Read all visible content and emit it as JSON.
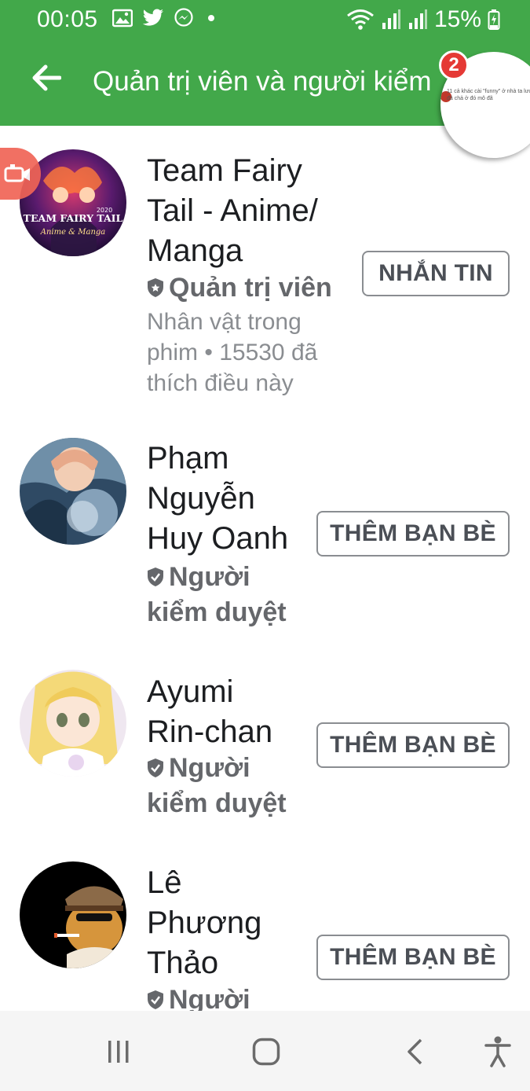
{
  "status": {
    "time": "00:05",
    "battery": "15%"
  },
  "appbar": {
    "title": "Quản trị viên và người kiểm duyệt"
  },
  "chathead": {
    "badge_count": "2",
    "preview_text": "11 cả khác cài \"funny\" ở nhà ta lưu đã chả ở đó mô đã"
  },
  "members": [
    {
      "name_lines": [
        "Team Fairy",
        "Tail - Anime/",
        "Manga"
      ],
      "role": "Quản trị viên",
      "meta_lines": [
        "Nhân vật trong",
        "phim • 15530 đã",
        "thích điều này"
      ],
      "action": "NHẮN TIN"
    },
    {
      "name_lines": [
        "Phạm",
        "Nguyễn",
        "Huy Oanh"
      ],
      "role_lines": [
        "Người",
        "kiểm duyệt"
      ],
      "action": "THÊM BẠN BÈ"
    },
    {
      "name_lines": [
        "Ayumi",
        "Rin-chan"
      ],
      "role_lines": [
        "Người",
        "kiểm duyệt"
      ],
      "action": "THÊM BẠN BÈ"
    },
    {
      "name_lines": [
        "Lê",
        "Phương",
        "Thảo"
      ],
      "role_lines": [
        "Người"
      ],
      "action": "THÊM BẠN BÈ"
    }
  ],
  "avatar_texts": {
    "member1": "TEAM FAIRY TAIL",
    "member1_sub": "Anime & Manga",
    "member1_year": "2020"
  },
  "colors": {
    "appbar": "#42a84a",
    "badge": "#e53935",
    "recorder": "#f06456"
  },
  "icons": {
    "back": "arrow-left-icon",
    "role": "shield-icon",
    "nav_recents": "recents-icon",
    "nav_home": "home-icon",
    "nav_back": "chevron-left-icon",
    "nav_accessibility": "accessibility-icon"
  }
}
